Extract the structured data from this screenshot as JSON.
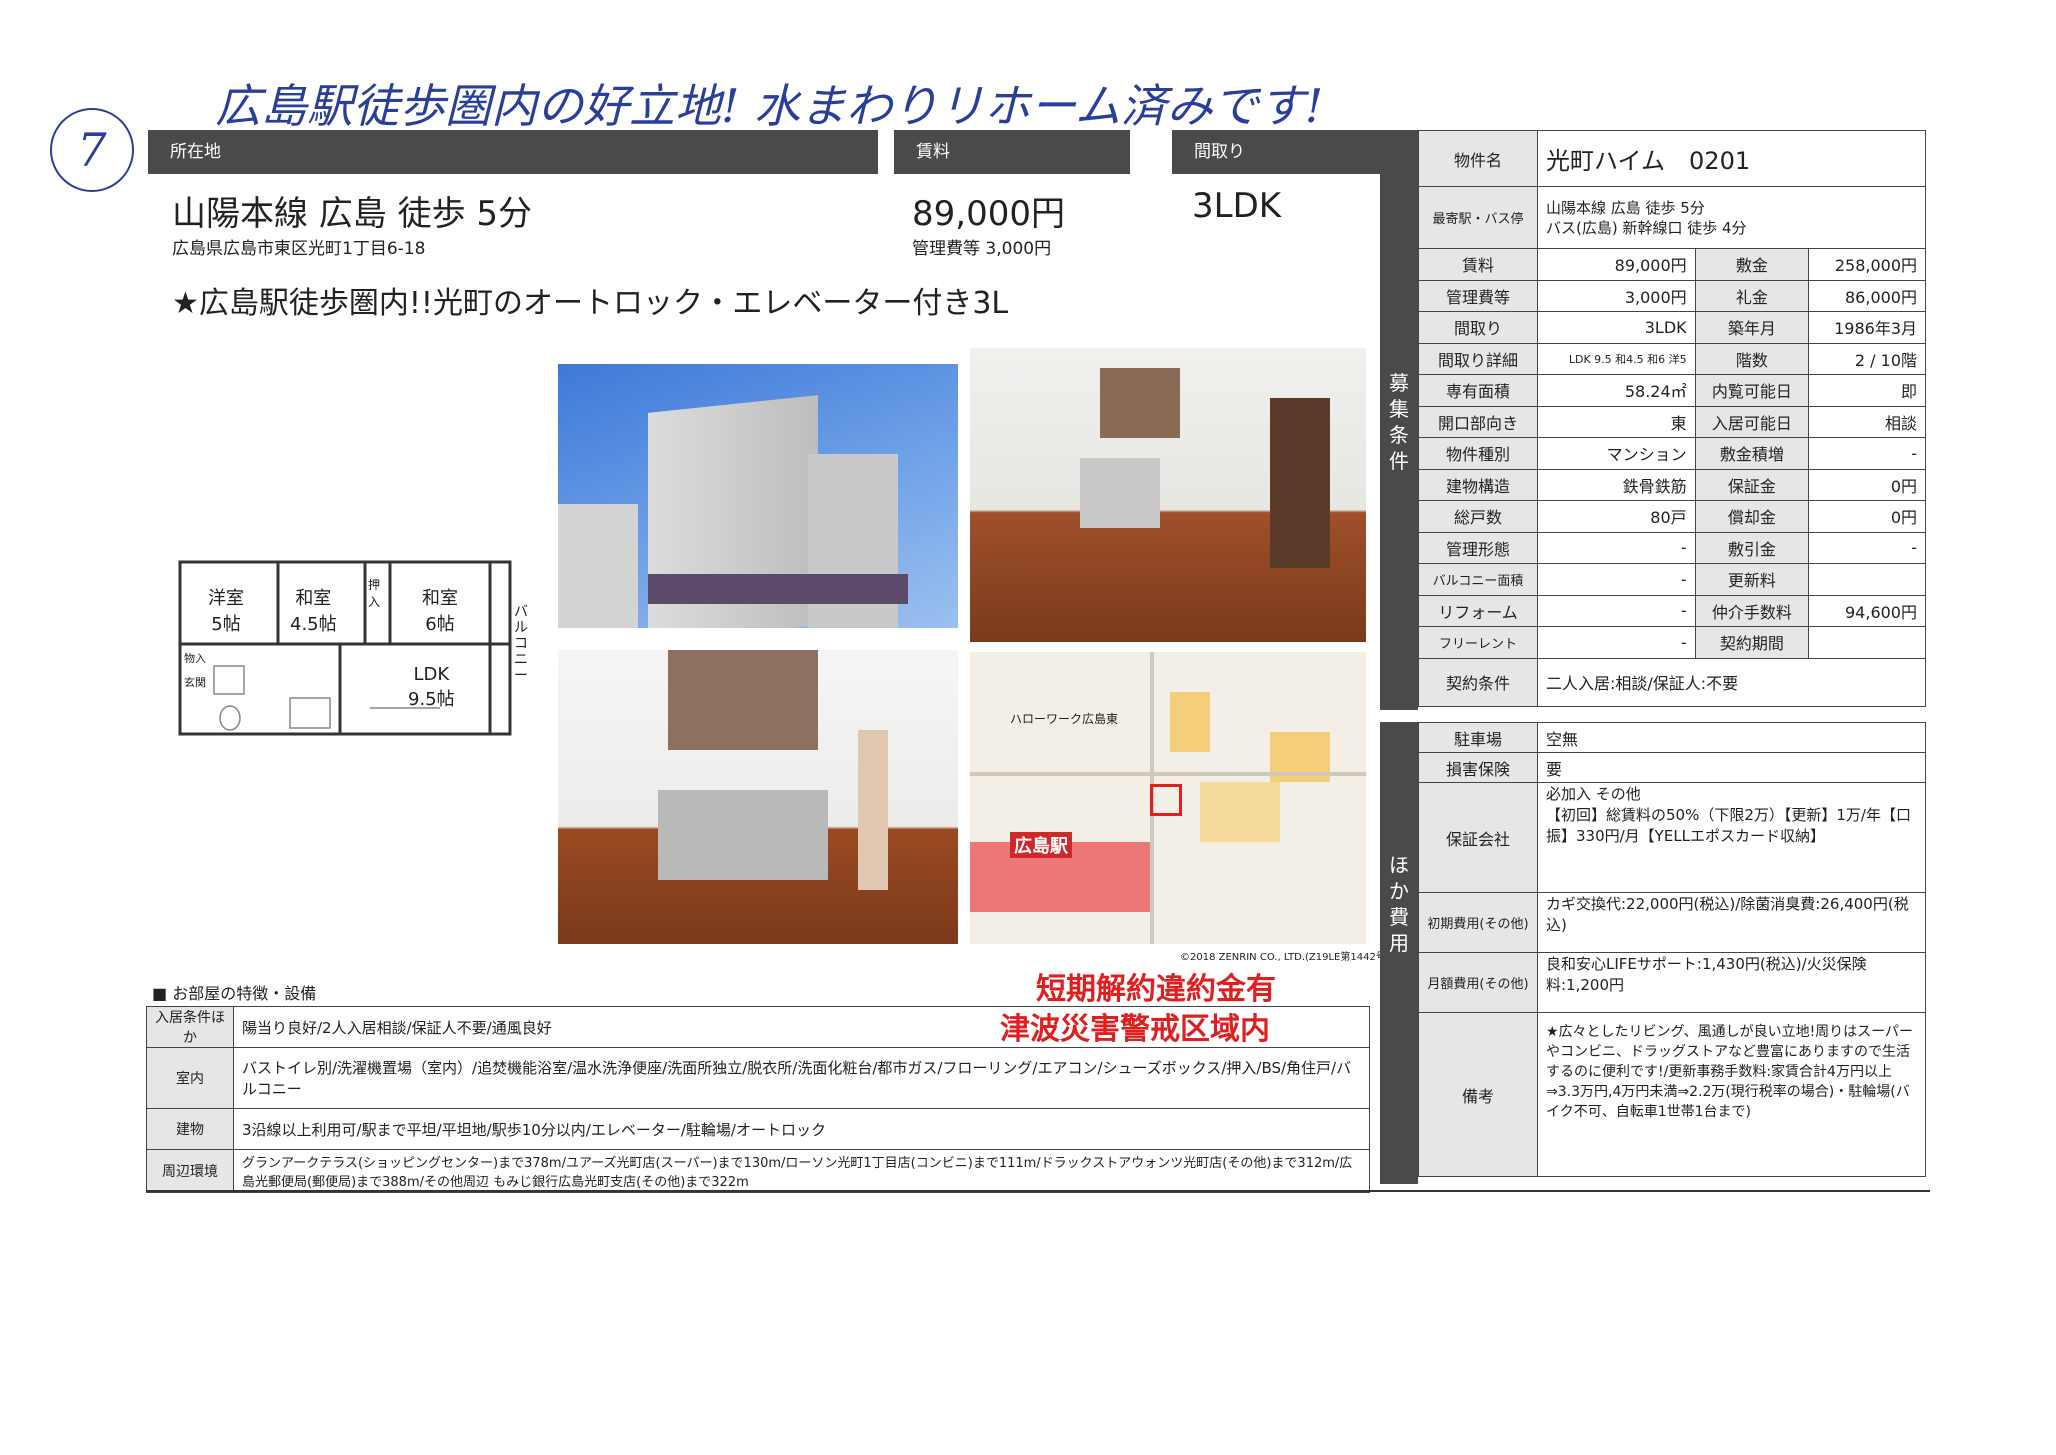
{
  "handwritten": {
    "number": "7",
    "note": "広島駅徒歩圏内の好立地! 水まわりリホーム済みです!"
  },
  "headers": {
    "location": "所在地",
    "rent": "賃料",
    "layout": "間取り"
  },
  "summary": {
    "access": "山陽本線 広島 徒歩 5分",
    "address": "広島県広島市東区光町1丁目6-18",
    "rent": "89,000円",
    "mgmt": "管理費等 3,000円",
    "layout": "3LDK"
  },
  "catch": "★広島駅徒歩圏内!!光町のオートロック・エレベーター付き3L",
  "floorplan": {
    "r1": "洋室",
    "r1s": "5帖",
    "r2": "和室",
    "r2s": "4.5帖",
    "r3": "和室",
    "r3s": "6帖",
    "ldk": "LDK",
    "ldks": "9.5帖",
    "balcony": "バルコニー",
    "oshi": "押入",
    "mono": "物入",
    "genkan": "玄関"
  },
  "map": {
    "station": "広島駅",
    "credit": "©2018 ZENRIN CO., LTD.(Z19LE第1442号)",
    "hw": "ハローワーク広島東"
  },
  "features": {
    "title": "■ お部屋の特徴・設備",
    "rows": [
      {
        "label": "入居条件ほか",
        "value": "陽当り良好/2人入居相談/保証人不要/通風良好"
      },
      {
        "label": "室内",
        "value": "バストイレ別/洗濯機置場（室内）/追焚機能浴室/温水洗浄便座/洗面所独立/脱衣所/洗面化粧台/都市ガス/フローリング/エアコン/シューズボックス/押入/BS/角住戸/バルコニー"
      },
      {
        "label": "建物",
        "value": "3沿線以上利用可/駅まで平坦/平坦地/駅歩10分以内/エレベーター/駐輪場/オートロック"
      },
      {
        "label": "周辺環境",
        "value": "グランアークテラス(ショッピングセンター)まで378m/ユアーズ光町店(スーパー)まで130m/ローソン光町1丁目店(コンビニ)まで111m/ドラックストアウォンツ光町店(その他)まで312m/広島光郵便局(郵便局)まで388m/その他周辺 もみじ銀行広島光町支店(その他)まで322m"
      }
    ]
  },
  "stamps": {
    "s1": "短期解約違約金有",
    "s2": "津波災害警戒区域内"
  },
  "side": {
    "name_l": "物件名",
    "name": "光町ハイム　0201",
    "station_l": "最寄駅・バス停",
    "station1": "山陽本線 広島 徒歩 5分",
    "station2": "バス(広島) 新幹線口 徒歩 4分",
    "tag1": "募集条件",
    "tag2": "ほか費用",
    "rows": [
      [
        "賃料",
        "89,000円",
        "敷金",
        "258,000円"
      ],
      [
        "管理費等",
        "3,000円",
        "礼金",
        "86,000円"
      ],
      [
        "間取り",
        "3LDK",
        "築年月",
        "1986年3月"
      ],
      [
        "間取り詳細",
        "LDK 9.5 和4.5 和6 洋5",
        "階数",
        "2 / 10階"
      ],
      [
        "専有面積",
        "58.24㎡",
        "内覧可能日",
        "即"
      ],
      [
        "開口部向き",
        "東",
        "入居可能日",
        "相談"
      ],
      [
        "物件種別",
        "マンション",
        "敷金積増",
        "-"
      ],
      [
        "建物構造",
        "鉄骨鉄筋",
        "保証金",
        "0円"
      ],
      [
        "総戸数",
        "80戸",
        "償却金",
        "0円"
      ],
      [
        "管理形態",
        "-",
        "敷引金",
        "-"
      ],
      [
        "バルコニー面積",
        "-",
        "更新料",
        ""
      ],
      [
        "リフォーム",
        "-",
        "仲介手数料",
        "94,600円"
      ],
      [
        "フリーレント",
        "-",
        "契約期間",
        ""
      ]
    ],
    "contract_l": "契約条件",
    "contract": "二人入居:相談/保証人:不要",
    "parking_l": "駐車場",
    "parking": "空無",
    "ins_l": "損害保険",
    "ins": "要",
    "guar_l": "保証会社",
    "guar": "必加入 その他\n【初回】総賃料の50%（下限2万）【更新】1万/年【口振】330円/月【YELLエポスカード収納】",
    "init_l": "初期費用(その他)",
    "init": "カギ交換代:22,000円(税込)/除菌消臭費:26,400円(税込)",
    "month_l": "月額費用(その他)",
    "month": "良和安心LIFEサポート:1,430円(税込)/火災保険料:1,200円",
    "notes_l": "備考",
    "notes": "★広々としたリビング、風通しが良い立地!周りはスーパーやコンビニ、ドラッグストアなど豊富にありますので生活するのに便利です!/更新事務手数料:家賃合計4万円以上⇒3.3万円,4万円未満⇒2.2万(現行税率の場合)・駐輪場(バイク不可、自転車1世帯1台まで)"
  }
}
